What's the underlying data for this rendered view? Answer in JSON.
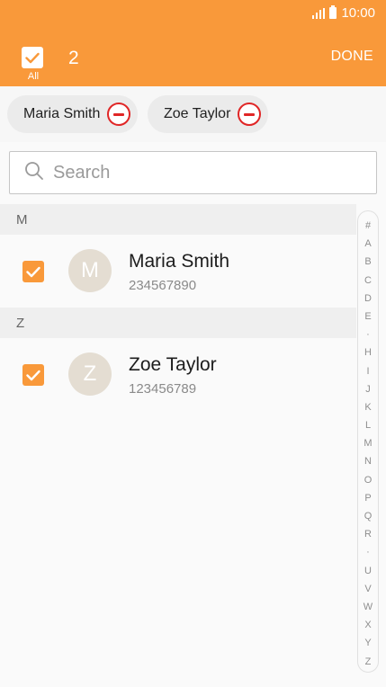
{
  "status_bar": {
    "time": "10:00",
    "signal_icon": "signal-icon",
    "battery_icon": "battery-icon"
  },
  "header": {
    "select_all_label": "All",
    "selected_count": "2",
    "done_label": "DONE",
    "checkbox_icon": "checkmark-icon",
    "accent_color": "#f9993a"
  },
  "chips": [
    {
      "name": "Maria Smith",
      "remove_icon": "remove-minus-icon"
    },
    {
      "name": "Zoe Taylor",
      "remove_icon": "remove-minus-icon"
    }
  ],
  "search": {
    "placeholder": "Search",
    "icon": "search-icon"
  },
  "sections": [
    {
      "letter": "M",
      "contact": {
        "initial": "M",
        "name": "Maria Smith",
        "number": "234567890",
        "checked": true
      }
    },
    {
      "letter": "Z",
      "contact": {
        "initial": "Z",
        "name": "Zoe Taylor",
        "number": "123456789",
        "checked": true
      }
    }
  ],
  "index_letters": [
    "#",
    "A",
    "B",
    "C",
    "D",
    "E",
    "·",
    "H",
    "I",
    "J",
    "K",
    "L",
    "M",
    "N",
    "O",
    "P",
    "Q",
    "R",
    "·",
    "U",
    "V",
    "W",
    "X",
    "Y",
    "Z"
  ]
}
